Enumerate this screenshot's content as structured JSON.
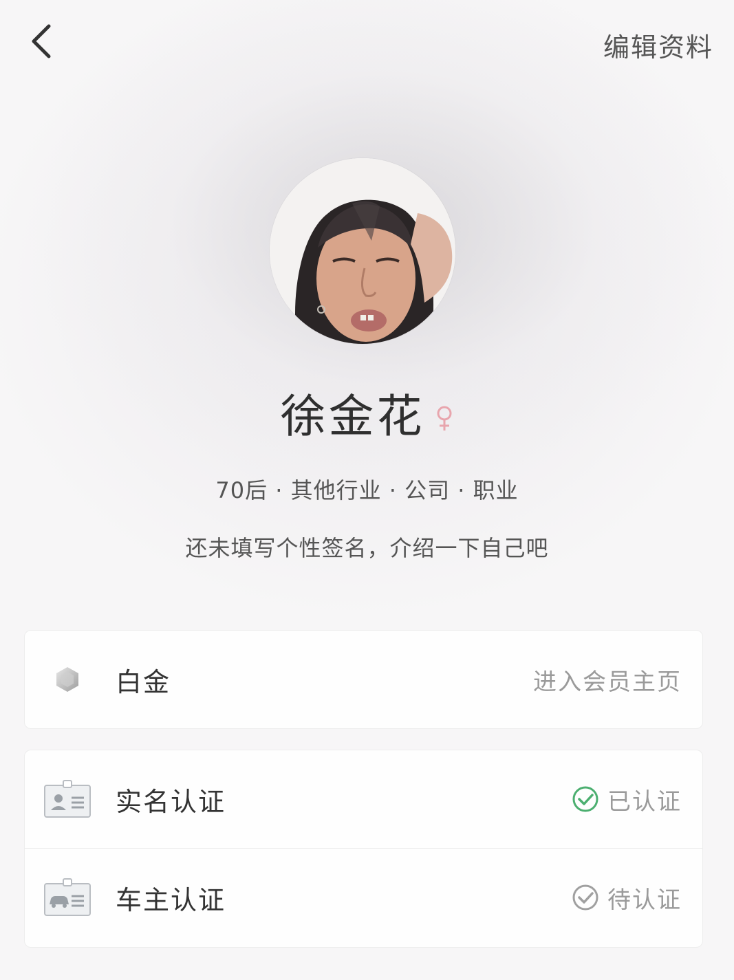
{
  "header": {
    "edit_label": "编辑资料"
  },
  "profile": {
    "name": "徐金花",
    "gender_icon": "female-icon",
    "meta": "70后 · 其他行业 · 公司 · 职业",
    "bio": "还未填写个性签名，介绍一下自己吧"
  },
  "membership": {
    "level": "白金",
    "icon": "platinum-badge-icon",
    "link_label": "进入会员主页"
  },
  "verifications": [
    {
      "label": "实名认证",
      "icon": "id-card-icon",
      "status": "已认证",
      "status_icon": "check-circle-green-icon",
      "status_color": "#4caf70"
    },
    {
      "label": "车主认证",
      "icon": "car-card-icon",
      "status": "待认证",
      "status_icon": "check-circle-gray-icon",
      "status_color": "#a0a0a0"
    }
  ],
  "colors": {
    "verified": "#4caf70",
    "pending": "#a0a0a0",
    "female": "#e8a5ad"
  }
}
